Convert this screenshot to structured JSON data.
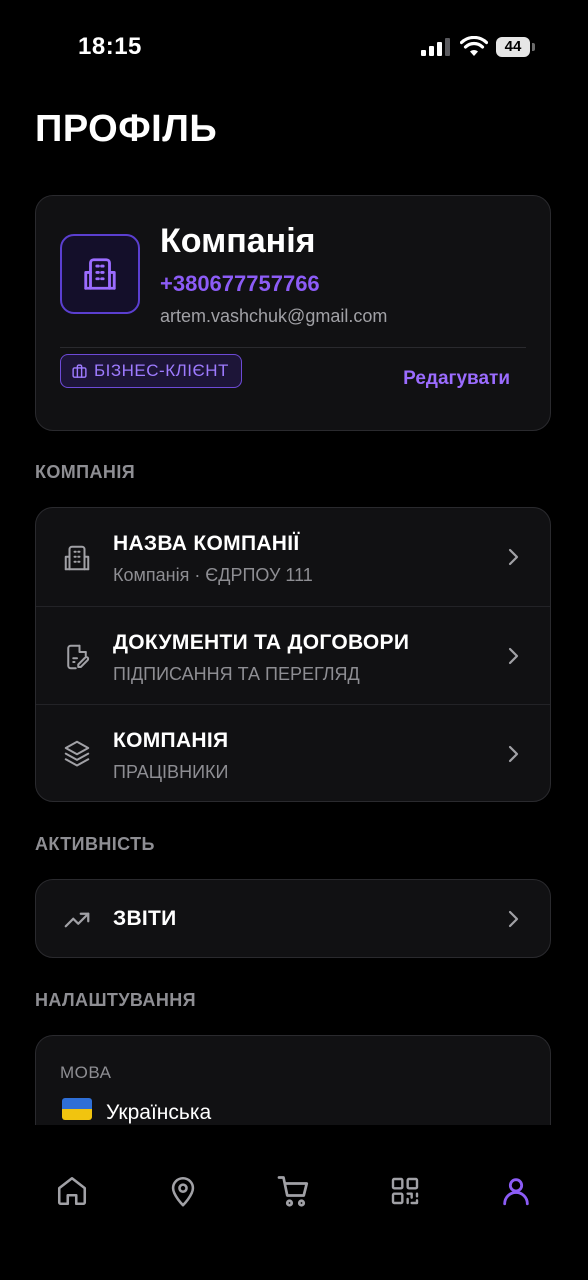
{
  "status_bar": {
    "time": "18:15",
    "battery": "44"
  },
  "page": {
    "title": "ПРОФІЛЬ"
  },
  "profile": {
    "name": "Компанія",
    "phone": "+380677757766",
    "email": "artem.vashchuk@gmail.com",
    "badge": "БІЗНЕС-КЛІЄНТ",
    "edit_label": "Редагувати",
    "avatar_icon": "building-icon"
  },
  "sections": {
    "company": {
      "label": "КОМПАНІЯ",
      "items": [
        {
          "title": "НАЗВА КОМПАНІЇ",
          "subtitle": "Компанія · ЄДРПОУ 111",
          "icon": "building-icon"
        },
        {
          "title": "ДОКУМЕНТИ ТА ДОГОВОРИ",
          "subtitle": "ПІДПИСАННЯ ТА ПЕРЕГЛЯД",
          "icon": "document-edit-icon"
        },
        {
          "title": "КОМПАНІЯ",
          "subtitle": "ПРАЦІВНИКИ",
          "icon": "layers-icon"
        }
      ]
    },
    "activity": {
      "label": "АКТИВНІСТЬ",
      "items": [
        {
          "title": "ЗВІТИ",
          "icon": "trending-up-icon"
        }
      ]
    },
    "settings": {
      "label": "НАЛАШТУВАННЯ",
      "language_label": "МОВА",
      "language_value": "Українська"
    }
  },
  "tab_bar": {
    "tabs": [
      "home-icon",
      "location-pin-icon",
      "cart-icon",
      "qr-code-icon",
      "user-icon"
    ],
    "active": "user-icon"
  },
  "colors": {
    "background": "#000000",
    "card": "#111113",
    "accent": "#8c5cf6",
    "muted": "#8e8e93"
  }
}
